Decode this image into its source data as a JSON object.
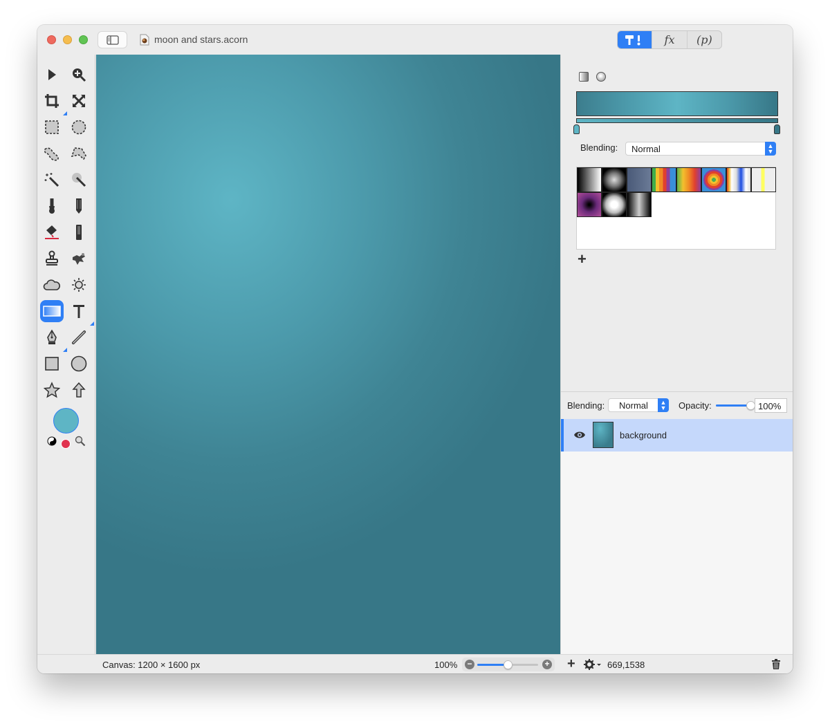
{
  "window": {
    "title": "moon and stars.acorn",
    "mode_tabs": [
      {
        "name": "tools",
        "label": "T!",
        "active": true
      },
      {
        "name": "effects",
        "label": "fx",
        "active": false
      },
      {
        "name": "properties",
        "label": "(p)",
        "active": false
      }
    ]
  },
  "toolbox": {
    "tools": [
      {
        "icon": "arrow-select-icon"
      },
      {
        "icon": "zoom-icon"
      },
      {
        "icon": "crop-icon"
      },
      {
        "icon": "transform-icon"
      },
      {
        "icon": "rect-select-icon"
      },
      {
        "icon": "ellipse-select-icon"
      },
      {
        "icon": "lasso-icon"
      },
      {
        "icon": "polygon-lasso-icon"
      },
      {
        "icon": "magic-wand-icon"
      },
      {
        "icon": "instant-alpha-icon"
      },
      {
        "icon": "brush-icon"
      },
      {
        "icon": "pencil-icon"
      },
      {
        "icon": "paint-bucket-icon"
      },
      {
        "icon": "eraser-icon"
      },
      {
        "icon": "clone-stamp-icon"
      },
      {
        "icon": "smudge-icon"
      },
      {
        "icon": "cloud-icon"
      },
      {
        "icon": "sun-icon"
      },
      {
        "icon": "gradient-icon",
        "active": true
      },
      {
        "icon": "text-icon"
      },
      {
        "icon": "pen-icon"
      },
      {
        "icon": "line-icon"
      },
      {
        "icon": "rectangle-shape-icon"
      },
      {
        "icon": "oval-shape-icon"
      },
      {
        "icon": "star-shape-icon"
      },
      {
        "icon": "arrow-shape-icon"
      }
    ],
    "colors": {
      "foreground": "#5eb5c5",
      "background": "#e0324e"
    }
  },
  "gradient_panel": {
    "start_color": "#5eb5c5",
    "end_color": "#377787",
    "blending_label": "Blending:",
    "blending_value": "Normal",
    "add_label": "+"
  },
  "layers_panel": {
    "blending_label": "Blending:",
    "blending_value": "Normal",
    "opacity_label": "Opacity:",
    "opacity_value": "100%",
    "opacity_fraction": 1.0,
    "layers": [
      {
        "name": "background",
        "visible": true,
        "selected": true
      }
    ]
  },
  "statusbar": {
    "canvas_size": "Canvas: 1200 × 1600 px",
    "zoom_level": "100%",
    "zoom_fraction": 0.5,
    "cursor_position": "669,1538"
  }
}
